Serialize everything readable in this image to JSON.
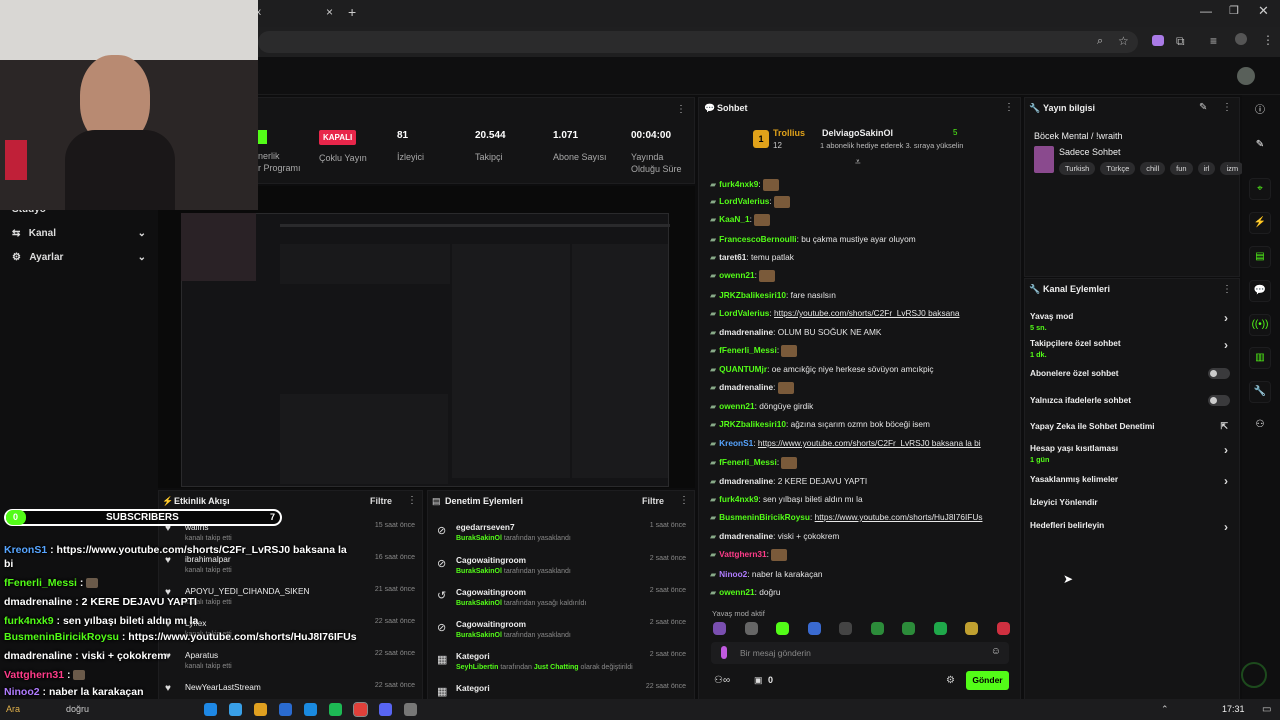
{
  "browser": {
    "tab_close": "x",
    "tab_close2": "×",
    "new_tab": "+"
  },
  "nav": {
    "studio": "Stüdyo",
    "kanal": "Kanal",
    "ayarlar": "Ayarlar"
  },
  "stats": {
    "partner": "nerlik\nr Programı",
    "kapali_badge": "KAPALI",
    "kapali_label": "Çoklu Yayın",
    "viewers": "81",
    "viewers_label": "İzleyici",
    "followers": "20.544",
    "followers_label": "Takipçi",
    "subs": "1.071",
    "subs_label": "Abone Sayısı",
    "uptime": "00:04:00",
    "uptime_label": "Yayında\nOlduğu Süre"
  },
  "chat": {
    "title": "Sohbet",
    "pin_user1": "Trollius",
    "pin_count1": "12",
    "pin_user2": "DelviagoSakinOl",
    "pin_count2": "5",
    "pin_msg": "1 abonelik hediye ederek 3. sıraya yükselin",
    "lines": [
      {
        "u": "furk4nxk9",
        "c": "#53fc18",
        "m": ""
      },
      {
        "u": "LordValerius",
        "c": "#53fc18",
        "m": ""
      },
      {
        "u": "KaaN_1",
        "c": "#53fc18",
        "m": ""
      },
      {
        "u": "FrancescoBernoulli",
        "c": "#53fc18",
        "m": "bu çakma mustiye ayar oluyom"
      },
      {
        "u": "taret61",
        "c": "#e8e8e8",
        "m": "temu patlak"
      },
      {
        "u": "owenn21",
        "c": "#53fc18",
        "m": ""
      },
      {
        "u": "JRKZbalikesiri10",
        "c": "#53fc18",
        "m": "fare nasılsın"
      },
      {
        "u": "LordValerius",
        "c": "#53fc18",
        "m": "https://youtube.com/shorts/C2Fr_LvRSJ0 baksana"
      },
      {
        "u": "dmadrenaline",
        "c": "#e8e8e8",
        "m": "OLUM BU SOĞUK NE AMK"
      },
      {
        "u": "fFenerli_Messi",
        "c": "#53fc18",
        "m": ""
      },
      {
        "u": "QUANTUMjr",
        "c": "#53fc18",
        "m": "oe amcıkğiç niye herkese sövüyon amcıkpiç"
      },
      {
        "u": "dmadrenaline",
        "c": "#e8e8e8",
        "m": ""
      },
      {
        "u": "owenn21",
        "c": "#53fc18",
        "m": "döngüye girdik"
      },
      {
        "u": "JRKZbalikesiri10",
        "c": "#53fc18",
        "m": "ağzına sıçarım ozmn bok böceği isem"
      },
      {
        "u": "KreonS1",
        "c": "#57a5ff",
        "m": "https://www.youtube.com/shorts/C2Fr_LvRSJ0 baksana la bi"
      },
      {
        "u": "fFenerli_Messi",
        "c": "#53fc18",
        "m": ""
      },
      {
        "u": "dmadrenaline",
        "c": "#e8e8e8",
        "m": "2 KERE DEJAVU YAPTI"
      },
      {
        "u": "furk4nxk9",
        "c": "#53fc18",
        "m": "sen yılbaşı bileti aldın mı la"
      },
      {
        "u": "BusmeninBiricikRoysu",
        "c": "#53fc18",
        "m": "https://www.youtube.com/shorts/HuJ8I76IFUs"
      },
      {
        "u": "dmadrenaline",
        "c": "#e8e8e8",
        "m": "viski + çokokrem"
      },
      {
        "u": "Vattghern31",
        "c": "#ff3c8a",
        "m": ""
      },
      {
        "u": "Ninoo2",
        "c": "#b07cff",
        "m": "naber la karakaçan"
      },
      {
        "u": "owenn21",
        "c": "#53fc18",
        "m": "doğru"
      }
    ],
    "slow_mode": "Yavaş mod aktif",
    "input_placeholder": "Bir mesaj gönderin",
    "send": "Gönder",
    "count": "0"
  },
  "info": {
    "title": "Yayın bilgisi",
    "stream_title": "Böcek Mental / !wraith",
    "category": "Sadece Sohbet",
    "tags": [
      "Turkish",
      "Türkçe",
      "chill",
      "fun",
      "irl",
      "izm"
    ]
  },
  "actions": {
    "title": "Kanal Eylemleri",
    "items": [
      {
        "label": "Yavaş mod",
        "sub": "5 sn.",
        "ctl": "chev"
      },
      {
        "label": "Takipçilere özel sohbet",
        "sub": "1 dk.",
        "ctl": "chev"
      },
      {
        "label": "Abonelere özel sohbet",
        "sub": "",
        "ctl": "toggle"
      },
      {
        "label": "Yalnızca ifadelerle sohbet",
        "sub": "",
        "ctl": "toggle"
      },
      {
        "label": "Yapay Zeka ile Sohbet Denetimi",
        "sub": "",
        "ctl": "ext"
      },
      {
        "label": "Hesap yaşı kısıtlaması",
        "sub": "1 gün",
        "ctl": "chev"
      },
      {
        "label": "Yasaklanmış kelimeler",
        "sub": "",
        "ctl": "chev"
      },
      {
        "label": "İzleyici Yönlendir",
        "sub": "",
        "ctl": ""
      },
      {
        "label": "Hedefleri belirleyin",
        "sub": "",
        "ctl": "chev"
      }
    ]
  },
  "activity": {
    "title": "Etkinlik Akışı",
    "filter": "Filtre",
    "items": [
      {
        "name": "waifns",
        "sub": "kanalı takip etti",
        "time": "15 saat önce"
      },
      {
        "name": "ibrahimalpar",
        "sub": "kanalı takip etti",
        "time": "16 saat önce"
      },
      {
        "name": "APOYU_YEDI_CIHANDA_SIKEN",
        "sub": "kanalı takip etti",
        "time": "21 saat önce"
      },
      {
        "name": "Lyflex",
        "sub": "kanalı takip etti",
        "time": "22 saat önce"
      },
      {
        "name": "Aparatus",
        "sub": "kanalı takip etti",
        "time": "22 saat önce"
      },
      {
        "name": "NewYearLastStream",
        "sub": "",
        "time": "22 saat önce"
      }
    ]
  },
  "moderation": {
    "title": "Denetim Eylemleri",
    "filter": "Filtre",
    "items": [
      {
        "name": "egedarrseven7",
        "by": "BurakSakinOl",
        "sub": "tarafından yasaklandı",
        "time": "1 saat önce"
      },
      {
        "name": "Cagowaitingroom",
        "by": "BurakSakinOl",
        "sub": "tarafından yasaklandı",
        "time": "2 saat önce"
      },
      {
        "name": "Cagowaitingroom",
        "by": "BurakSakinOl",
        "sub": "tarafından yasağı kaldırıldı",
        "time": "2 saat önce"
      },
      {
        "name": "Cagowaitingroom",
        "by": "BurakSakinOl",
        "sub": "tarafından yasaklandı",
        "time": "2 saat önce"
      },
      {
        "name": "Kategori",
        "by": "SeyhLibertin",
        "sub": "tarafından",
        "sub2": "Just Chatting",
        "sub3": "olarak değiştirildi",
        "time": "2 saat önce"
      },
      {
        "name": "Kategori",
        "by": "",
        "sub": "",
        "time": "22 saat önce"
      }
    ]
  },
  "overlay": {
    "sub_left": "0",
    "sub_title": "SUBSCRIBERS",
    "sub_right": "7",
    "lines": [
      {
        "u": "KreonS1",
        "c": "#57a5ff",
        "m": "https://www.youtube.com/shorts/C2Fr_LvRSJ0 baksana la"
      },
      {
        "u": "",
        "c": "",
        "m": "bi"
      },
      {
        "u": "fFenerli_Messi",
        "c": "#53fc18",
        "m": ""
      },
      {
        "u": "dmadrenaline",
        "c": "#fff",
        "m": "2 KERE DEJAVU YAPTI"
      },
      {
        "u": "furk4nxk9",
        "c": "#53fc18",
        "m": "sen yılbaşı bileti aldın mı la"
      },
      {
        "u": "BusmeninBiricikRoysu",
        "c": "#53fc18",
        "m": "https://www.youtube.com/shorts/HuJ8I76IFUs"
      },
      {
        "u": "dmadrenaline",
        "c": "#fff",
        "m": "viski + çokokrem"
      },
      {
        "u": "Vattghern31",
        "c": "#ff3c8a",
        "m": ""
      },
      {
        "u": "Ninoo2",
        "c": "#b07cff",
        "m": "naber la karakaçan"
      }
    ]
  },
  "taskbar": {
    "time": "17:31",
    "weather": "Ara",
    "search": "doğru"
  },
  "colors": {
    "accent": "#53fc18",
    "danger": "#e8264a"
  }
}
